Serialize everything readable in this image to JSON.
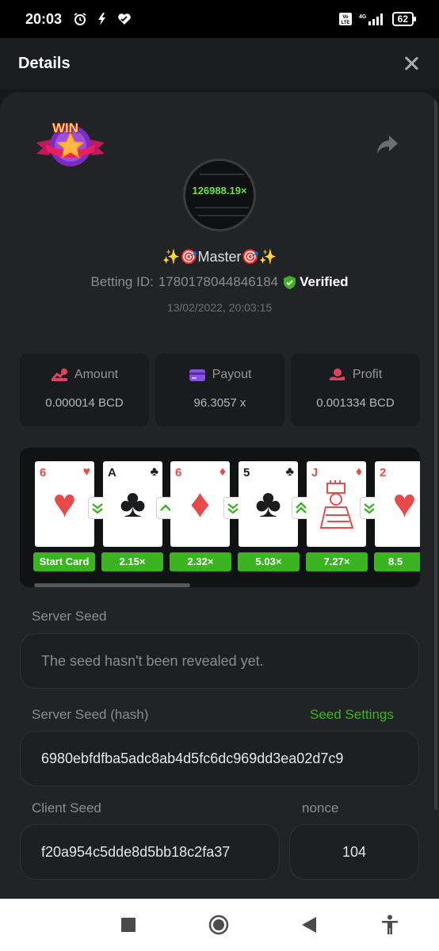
{
  "status_bar": {
    "time": "20:03",
    "battery": "62",
    "icons": [
      "alarm-icon",
      "flash-icon",
      "health-heart-icon",
      "volte-icon",
      "signal-4g-icon",
      "battery-icon"
    ]
  },
  "header": {
    "title": "Details"
  },
  "bet": {
    "badge_text": "WIN",
    "avatar_multiplier": "126988.19×",
    "username": "✨🎯Master🎯✨",
    "betting_id_label": "Betting ID:",
    "betting_id": "1780178044846184",
    "verified_label": "Verified",
    "timestamp": "13/02/2022, 20:03:15"
  },
  "stats": [
    {
      "label": "Amount",
      "value": "0.000014 BCD",
      "icon": "amount-icon",
      "color": "#e0445c"
    },
    {
      "label": "Payout",
      "value": "96.3057 x",
      "icon": "payout-card-icon",
      "color": "#8a4fe6"
    },
    {
      "label": "Profit",
      "value": "0.001334 BCD",
      "icon": "profit-icon",
      "color": "#e0445c"
    }
  ],
  "cards": [
    {
      "rank": "6",
      "suit": "♥",
      "color": "red",
      "multiplier": "Start Card"
    },
    {
      "rank": "A",
      "suit": "♣",
      "color": "black",
      "multiplier": "2.15×"
    },
    {
      "rank": "6",
      "suit": "♦",
      "color": "red",
      "multiplier": "2.32×"
    },
    {
      "rank": "5",
      "suit": "♣",
      "color": "black",
      "multiplier": "5.03×"
    },
    {
      "rank": "J",
      "suit": "♦",
      "color": "red",
      "multiplier": "7.27×"
    },
    {
      "rank": "2",
      "suit": "♥",
      "color": "red",
      "multiplier": "8.5"
    }
  ],
  "guesses": [
    "down",
    "up",
    "down",
    "up",
    "down"
  ],
  "seeds": {
    "server_seed_label": "Server Seed",
    "server_seed_value": "The seed hasn't been revealed yet.",
    "server_hash_label": "Server Seed (hash)",
    "seed_settings_label": "Seed Settings",
    "server_hash_value": "6980ebfdfba5adc8ab4d5fc6dc969dd3ea02d7c9",
    "client_seed_label": "Client Seed",
    "client_seed_value": "f20a954c5dde8d5bb18c2fa37",
    "nonce_label": "nonce",
    "nonce_value": "104"
  },
  "colors": {
    "accent_green": "#3cb321",
    "background": "#222327"
  }
}
